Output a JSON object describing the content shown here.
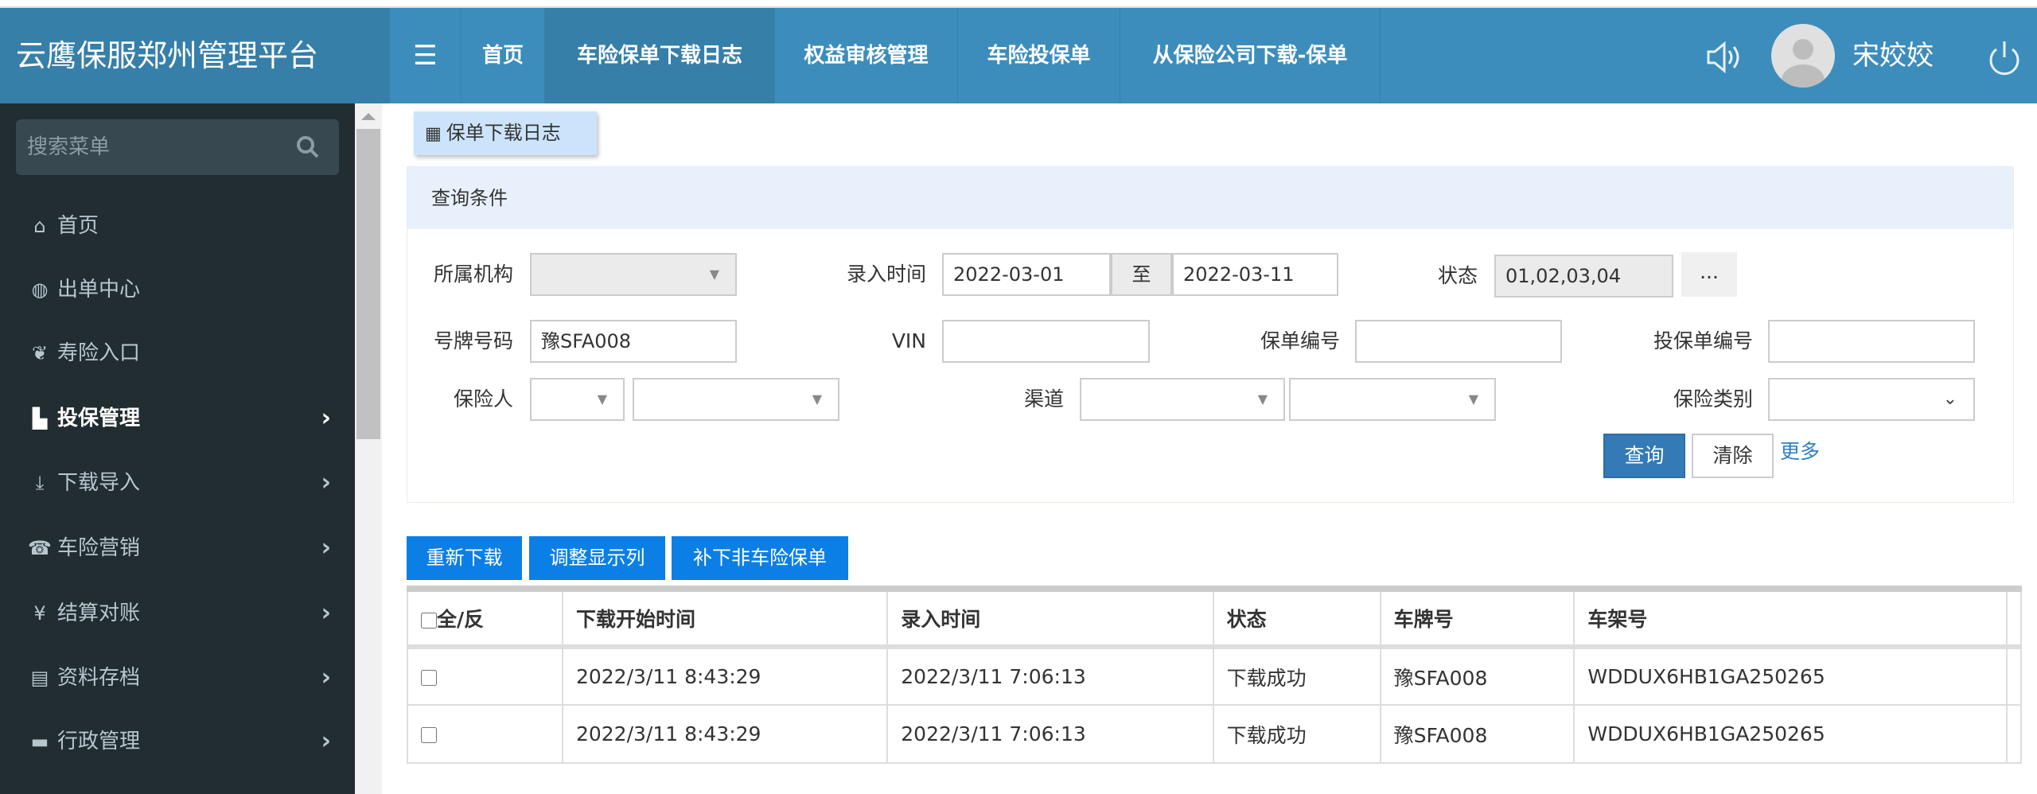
{
  "header": {
    "app_title": "云鹰保服郑州管理平台",
    "nav": [
      "首页",
      "车险保单下载日志",
      "权益审核管理",
      "车险投保单",
      "从保险公司下载-保单"
    ],
    "user_name": "宋姣姣"
  },
  "sidebar": {
    "search_placeholder": "搜索菜单",
    "items": [
      {
        "label": "首页",
        "icon": "home-icon",
        "glyph": "⌂",
        "chev": ""
      },
      {
        "label": "出单中心",
        "icon": "globe-icon",
        "glyph": "◍",
        "chev": ""
      },
      {
        "label": "寿险入口",
        "icon": "leaf-icon",
        "glyph": "❦",
        "chev": ""
      },
      {
        "label": "投保管理",
        "icon": "file-icon",
        "glyph": "▙",
        "chev": "›"
      },
      {
        "label": "下载导入",
        "icon": "import-icon",
        "glyph": "⤓",
        "chev": "›"
      },
      {
        "label": "车险营销",
        "icon": "phone-icon",
        "glyph": "☎",
        "chev": "›"
      },
      {
        "label": "结算对账",
        "icon": "yen-icon",
        "glyph": "¥",
        "chev": "›"
      },
      {
        "label": "资料存档",
        "icon": "list-icon",
        "glyph": "▤",
        "chev": "›"
      },
      {
        "label": "行政管理",
        "icon": "folder-icon",
        "glyph": "▬",
        "chev": "›"
      }
    ]
  },
  "breadcrumb": {
    "label": "保单下载日志"
  },
  "query": {
    "title": "查询条件",
    "org_label": "所属机构",
    "time_label": "录入时间",
    "date_from": "2022-03-01",
    "to_label": "至",
    "date_to": "2022-03-11",
    "status_label": "状态",
    "status_value": "01,02,03,04",
    "status_more": "...",
    "plate_label": "号牌号码",
    "plate_value": "豫SFA008",
    "vin_label": "VIN",
    "policy_label": "保单编号",
    "proposal_label": "投保单编号",
    "insurer_label": "保险人",
    "channel_label": "渠道",
    "type_label": "保险类别",
    "search_btn": "查询",
    "clear_btn": "清除",
    "more_link": "更多"
  },
  "actions": [
    "重新下载",
    "调整显示列",
    "补下非车险保单"
  ],
  "table": {
    "select_all": "全/反",
    "columns": [
      "下载开始时间",
      "录入时间",
      "状态",
      "车牌号",
      "车架号"
    ],
    "rows": [
      [
        "2022/3/11 8:43:29",
        "2022/3/11 7:06:13",
        "下载成功",
        "豫SFA008",
        "WDDUX6HB1GA250265"
      ],
      [
        "2022/3/11 8:43:29",
        "2022/3/11 7:06:13",
        "下载成功",
        "豫SFA008",
        "WDDUX6HB1GA250265"
      ]
    ]
  },
  "colors": {
    "header": "#3c8dbc",
    "header_active": "#367fa9",
    "sidebar": "#222d32",
    "action_button": "#0b7fe6",
    "primary_button": "#337ab7"
  }
}
